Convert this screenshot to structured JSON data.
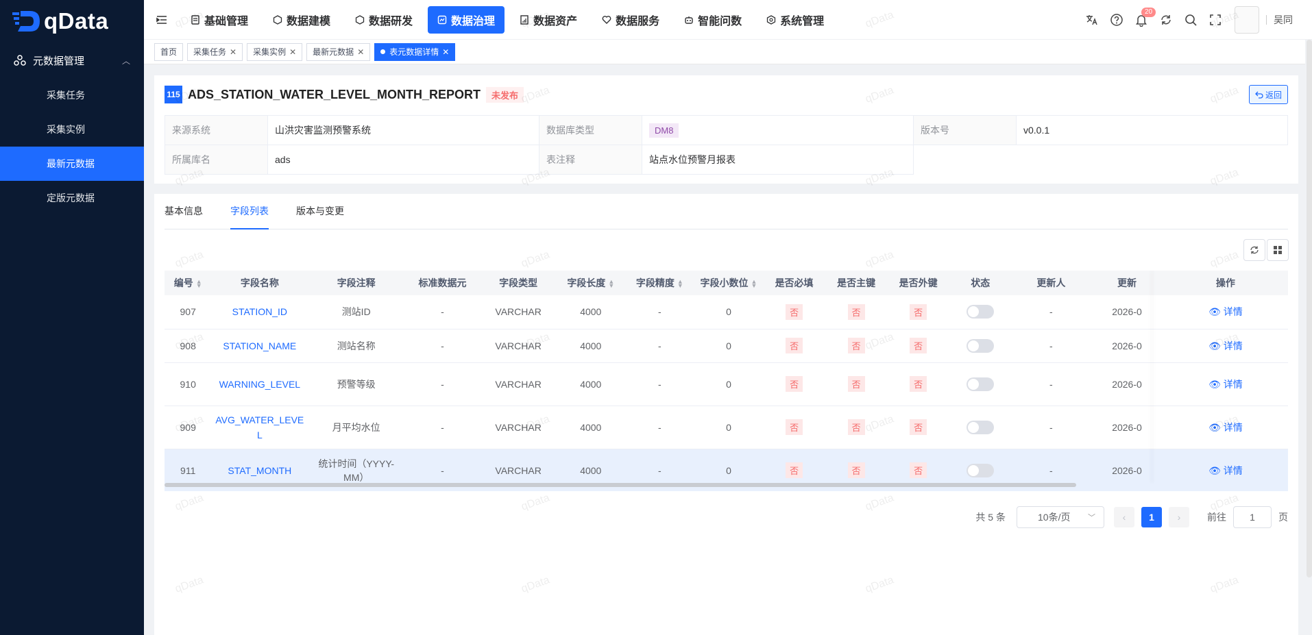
{
  "app": {
    "logo_text": "qData"
  },
  "sidebar": {
    "group_label": "元数据管理",
    "items": [
      {
        "label": "采集任务",
        "active": false
      },
      {
        "label": "采集实例",
        "active": false
      },
      {
        "label": "最新元数据",
        "active": true
      },
      {
        "label": "定版元数据",
        "active": false
      }
    ]
  },
  "topnav": {
    "items": [
      {
        "label": "基础管理",
        "icon": "database-icon"
      },
      {
        "label": "数据建模",
        "icon": "cube-icon"
      },
      {
        "label": "数据研发",
        "icon": "cube-icon"
      },
      {
        "label": "数据治理",
        "icon": "governance-icon",
        "active": true
      },
      {
        "label": "数据资产",
        "icon": "asset-icon"
      },
      {
        "label": "数据服务",
        "icon": "service-icon"
      },
      {
        "label": "智能问数",
        "icon": "robot-icon"
      },
      {
        "label": "系统管理",
        "icon": "settings-icon"
      }
    ],
    "notification_count": "20",
    "username": "吴同"
  },
  "tabs_bar": {
    "tabs": [
      {
        "label": "首页",
        "closable": false
      },
      {
        "label": "采集任务",
        "closable": true
      },
      {
        "label": "采集实例",
        "closable": true
      },
      {
        "label": "最新元数据",
        "closable": true
      },
      {
        "label": "表元数据详情",
        "closable": true,
        "active": true
      }
    ]
  },
  "header": {
    "id": "115",
    "title": "ADS_STATION_WATER_LEVEL_MONTH_REPORT",
    "status": "未发布",
    "back_label": "返回",
    "fields": {
      "source_system_label": "来源系统",
      "source_system": "山洪灾害监测预警系统",
      "db_type_label": "数据库类型",
      "db_type": "DM8",
      "version_label": "版本号",
      "version": "v0.0.1",
      "db_name_label": "所属库名",
      "db_name": "ads",
      "comment_label": "表注释",
      "comment": "站点水位预警月报表"
    }
  },
  "content_tabs": [
    {
      "label": "基本信息"
    },
    {
      "label": "字段列表",
      "active": true
    },
    {
      "label": "版本与变更"
    }
  ],
  "table": {
    "columns": [
      "编号",
      "字段名称",
      "字段注释",
      "标准数据元",
      "字段类型",
      "字段长度",
      "字段精度",
      "字段小数位",
      "是否必填",
      "是否主键",
      "是否外键",
      "状态",
      "更新人",
      "更新",
      "操作"
    ],
    "rows": [
      {
        "id": "907",
        "name": "STATION_ID",
        "comment": "测站ID",
        "std": "-",
        "type": "VARCHAR",
        "length": "4000",
        "precision": "-",
        "scale": "0",
        "required": "否",
        "pk": "否",
        "fk": "否",
        "status": false,
        "updater": "-",
        "updated": "2026-0",
        "op": "详情"
      },
      {
        "id": "908",
        "name": "STATION_NAME",
        "comment": "测站名称",
        "std": "-",
        "type": "VARCHAR",
        "length": "4000",
        "precision": "-",
        "scale": "0",
        "required": "否",
        "pk": "否",
        "fk": "否",
        "status": false,
        "updater": "-",
        "updated": "2026-0",
        "op": "详情"
      },
      {
        "id": "910",
        "name": "WARNING_LEVEL",
        "comment": "预警等级",
        "std": "-",
        "type": "VARCHAR",
        "length": "4000",
        "precision": "-",
        "scale": "0",
        "required": "否",
        "pk": "否",
        "fk": "否",
        "status": false,
        "updater": "-",
        "updated": "2026-0",
        "op": "详情"
      },
      {
        "id": "909",
        "name": "AVG_WATER_LEVEL",
        "comment": "月平均水位",
        "std": "-",
        "type": "VARCHAR",
        "length": "4000",
        "precision": "-",
        "scale": "0",
        "required": "否",
        "pk": "否",
        "fk": "否",
        "status": false,
        "updater": "-",
        "updated": "2026-0",
        "op": "详情"
      },
      {
        "id": "911",
        "name": "STAT_MONTH",
        "comment": "统计时间（YYYY-MM）",
        "std": "-",
        "type": "VARCHAR",
        "length": "4000",
        "precision": "-",
        "scale": "0",
        "required": "否",
        "pk": "否",
        "fk": "否",
        "status": false,
        "updater": "-",
        "updated": "2026-0",
        "op": "详情"
      }
    ]
  },
  "pagination": {
    "total_text": "共 5 条",
    "page_size": "10条/页",
    "current_page": "1",
    "goto_label": "前往",
    "goto_value": "1",
    "page_suffix": "页"
  },
  "watermark": "qData",
  "colors": {
    "primary": "#1e6bff",
    "sidebar_bg": "#0b1a32",
    "danger": "#f56c6c"
  }
}
